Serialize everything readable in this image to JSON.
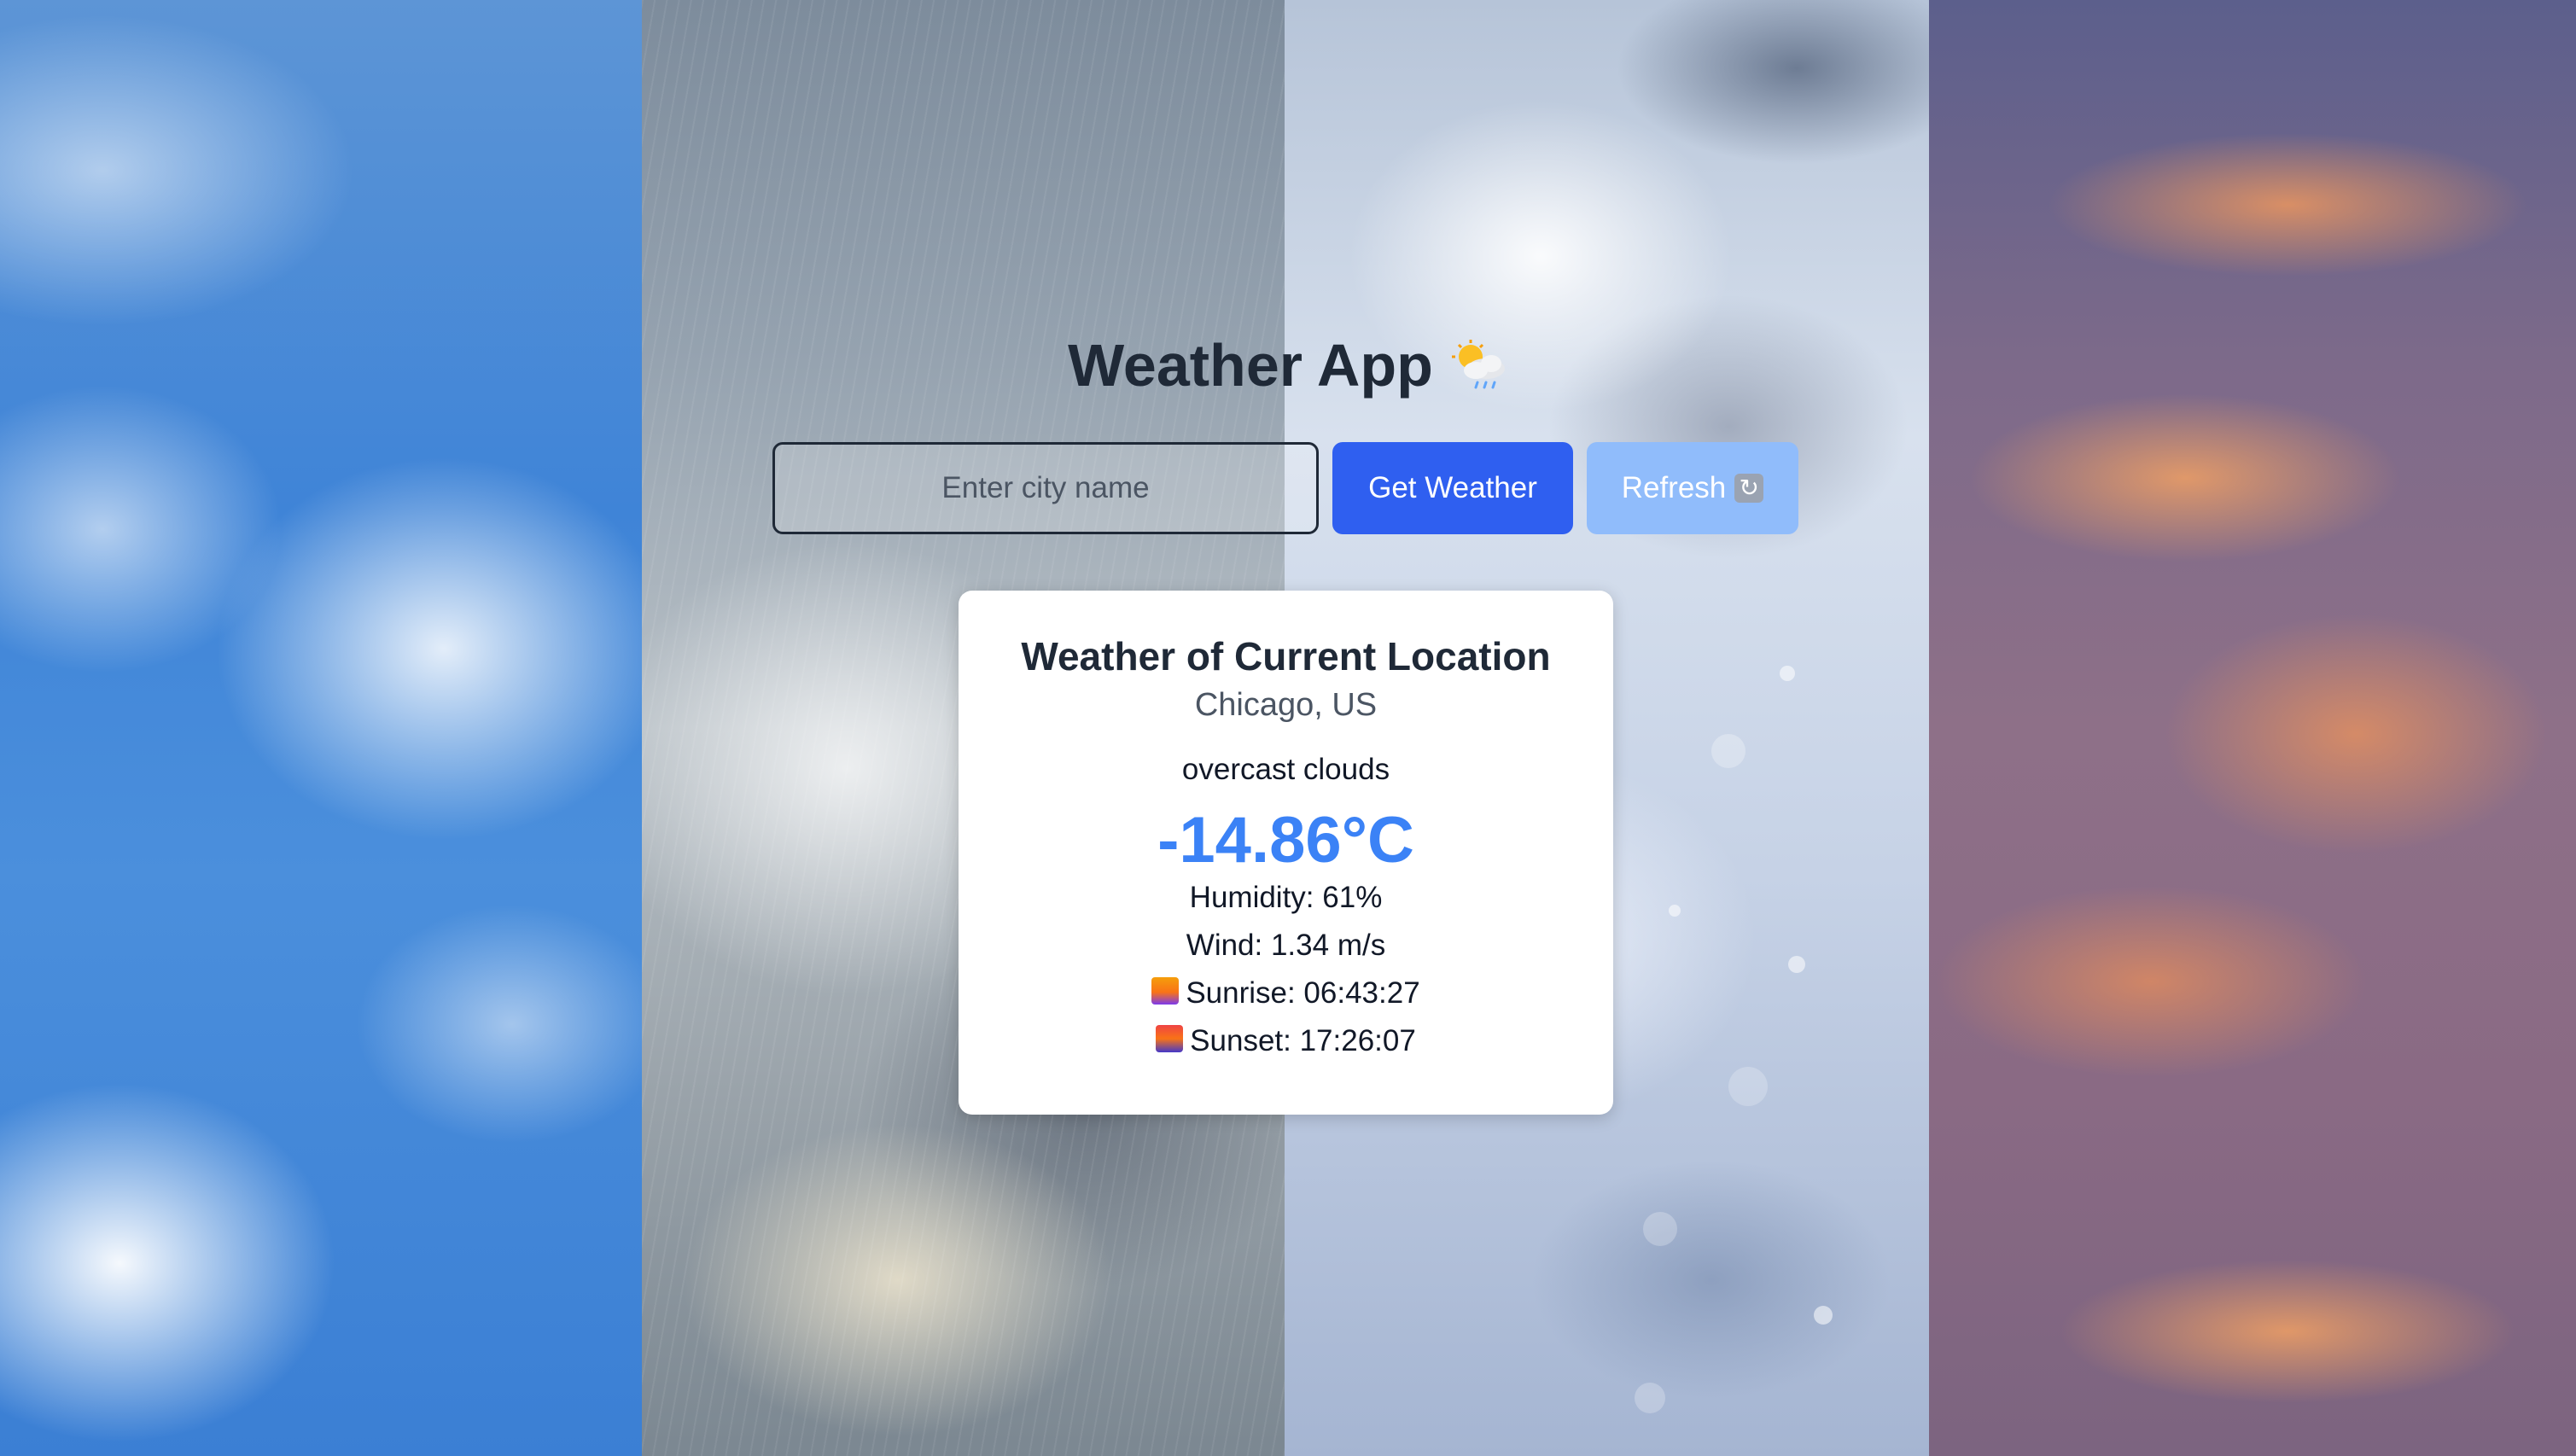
{
  "app": {
    "title": "Weather App",
    "title_icon": "sun-behind-rain-cloud-icon"
  },
  "search": {
    "placeholder": "Enter city name",
    "value": ""
  },
  "buttons": {
    "get_weather": "Get Weather",
    "refresh": "Refresh",
    "refresh_icon": "refresh-icon"
  },
  "card": {
    "heading": "Weather of Current Location",
    "location": "Chicago, US",
    "description": "overcast clouds",
    "temperature": "-14.86°C",
    "humidity": "Humidity: 61%",
    "wind": "Wind: 1.34 m/s",
    "sunrise": "Sunrise: 06:43:27",
    "sunset": "Sunset: 17:26:07",
    "sunrise_icon": "sunrise-icon",
    "sunset_icon": "sunset-icon"
  },
  "colors": {
    "title_text": "#1f2937",
    "primary_button": "#2f5ff0",
    "refresh_button": "#90bcfb",
    "temperature": "#3b82f6",
    "card_background": "#ffffff"
  }
}
